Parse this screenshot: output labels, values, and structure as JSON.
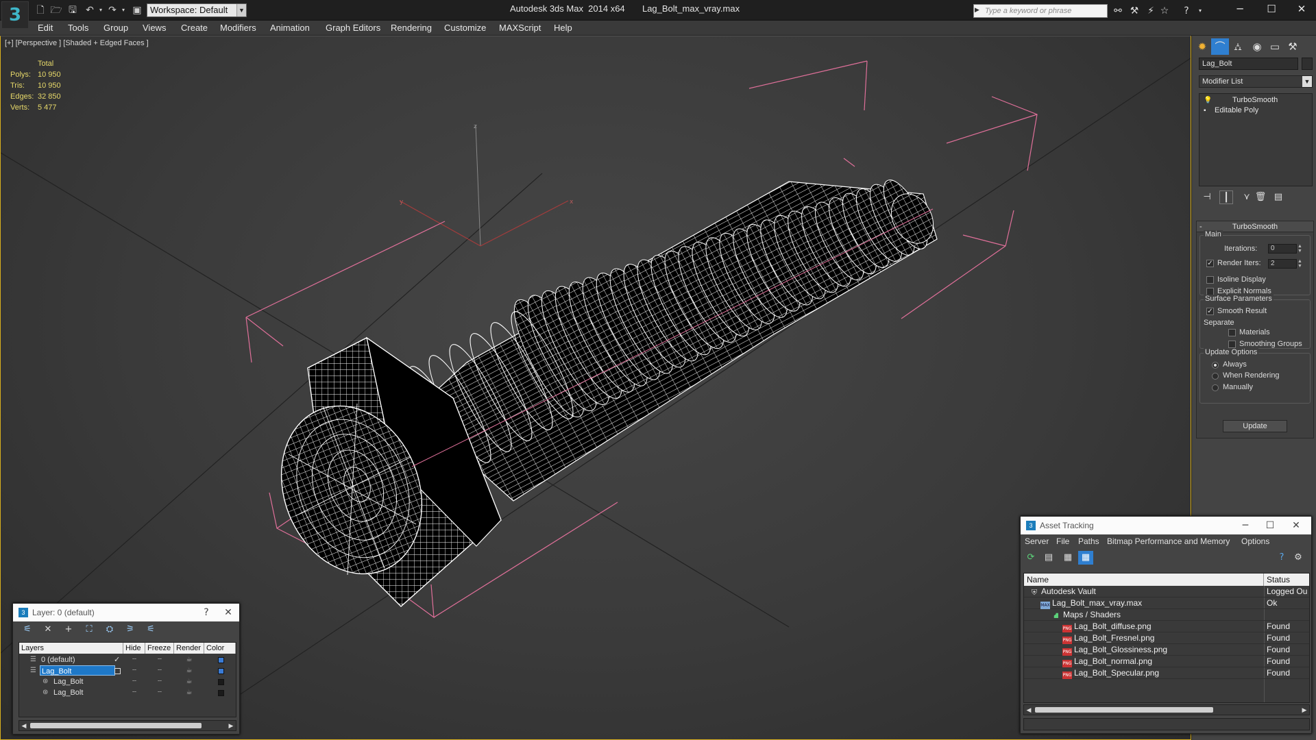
{
  "titlebar": {
    "app_logo": "3",
    "workspace_value": "Workspace: Default",
    "app_name": "Autodesk 3ds Max  2014 x64",
    "file_name": "Lag_Bolt_max_vray.max",
    "search_placeholder": "Type a keyword or phrase"
  },
  "menu": [
    "Edit",
    "Tools",
    "Group",
    "Views",
    "Create",
    "Modifiers",
    "Animation",
    "Graph Editors",
    "Rendering",
    "Customize",
    "MAXScript",
    "Help"
  ],
  "viewport": {
    "label": "[+] [Perspective ] [Shaded + Edged Faces ]",
    "stats_header": "Total",
    "stats": [
      {
        "label": "Polys:",
        "value": "10 950"
      },
      {
        "label": "Tris:",
        "value": "10 950"
      },
      {
        "label": "Edges:",
        "value": "32 850"
      },
      {
        "label": "Verts:",
        "value": "5 477"
      }
    ],
    "axis_labels": {
      "z": "z",
      "y": "y",
      "x": "x"
    },
    "colors": {
      "stats": "#e7d96a",
      "selection_bracket": "#e0709a",
      "wire": "#ffffff"
    }
  },
  "command_panel": {
    "object_name": "Lag_Bolt",
    "modifier_list": "Modifier List",
    "stack": [
      "TurboSmooth",
      "Editable Poly"
    ],
    "rollout": {
      "title": "TurboSmooth",
      "main_group": "Main",
      "iterations_label": "Iterations:",
      "iterations_value": "0",
      "render_iters_label": "Render Iters:",
      "render_iters_value": "2",
      "isoline_label": "Isoline Display",
      "explicit_normals_label": "Explicit Normals",
      "surface_group": "Surface Parameters",
      "smooth_result_label": "Smooth Result",
      "separate_label": "Separate",
      "materials_label": "Materials",
      "smoothing_groups_label": "Smoothing Groups",
      "update_group": "Update Options",
      "always_label": "Always",
      "when_rendering_label": "When Rendering",
      "manually_label": "Manually",
      "update_button": "Update"
    }
  },
  "layer_window": {
    "title": "Layer: 0 (default)",
    "help": "?",
    "close": "✕",
    "columns": [
      "Layers",
      "Hide",
      "Freeze",
      "Render",
      "Color"
    ],
    "rows": [
      {
        "name": "0 (default)",
        "level": 0,
        "selected": false,
        "color": "#3a7bd5",
        "active": true
      },
      {
        "name": "Lag_Bolt",
        "level": 0,
        "selected": true,
        "color": "#3a7bd5",
        "active": false
      },
      {
        "name": "Lag_Bolt",
        "level": 1,
        "selected": false,
        "color": "#1a1a1a",
        "active": false
      },
      {
        "name": "Lag_Bolt",
        "level": 1,
        "selected": false,
        "color": "#1a1a1a",
        "active": false
      }
    ]
  },
  "asset_window": {
    "title": "Asset Tracking",
    "menu": [
      "Server",
      "File",
      "Paths",
      "Bitmap Performance and Memory",
      "Options"
    ],
    "columns": [
      "Name",
      "Status"
    ],
    "rows": [
      {
        "name": "Autodesk Vault",
        "status": "Logged Ou",
        "level": 0,
        "icon": "vault"
      },
      {
        "name": "Lag_Bolt_max_vray.max",
        "status": "Ok",
        "level": 1,
        "icon": "max"
      },
      {
        "name": "Maps / Shaders",
        "status": "",
        "level": 2,
        "icon": "folder"
      },
      {
        "name": "Lag_Bolt_diffuse.png",
        "status": "Found",
        "level": 3,
        "icon": "png"
      },
      {
        "name": "Lag_Bolt_Fresnel.png",
        "status": "Found",
        "level": 3,
        "icon": "png"
      },
      {
        "name": "Lag_Bolt_Glossiness.png",
        "status": "Found",
        "level": 3,
        "icon": "png"
      },
      {
        "name": "Lag_Bolt_normal.png",
        "status": "Found",
        "level": 3,
        "icon": "png"
      },
      {
        "name": "Lag_Bolt_Specular.png",
        "status": "Found",
        "level": 3,
        "icon": "png"
      }
    ]
  }
}
